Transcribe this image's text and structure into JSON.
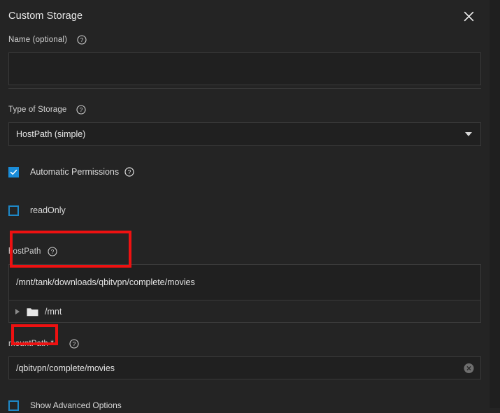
{
  "dialog": {
    "title": "Custom Storage",
    "close_icon": "close-icon"
  },
  "fields": {
    "name": {
      "label": "Name (optional)",
      "value": "",
      "placeholder": "",
      "help_icon": "help-circle-icon"
    },
    "type_of_storage": {
      "label": "Type of Storage",
      "selected": "HostPath (simple)",
      "help_icon": "help-circle-icon",
      "chevron_icon": "chevron-down-icon"
    },
    "automatic_permissions": {
      "label": "Automatic Permissions",
      "checked": true,
      "help_icon": "help-circle-icon"
    },
    "read_only": {
      "label": "readOnly",
      "checked": false
    },
    "host_path": {
      "label": "hostPath",
      "value": "/mnt/tank/downloads/qbitvpn/complete/movies",
      "help_icon": "help-circle-icon",
      "tree": [
        {
          "label": "/mnt",
          "expanded": false,
          "caret_icon": "caret-right-icon",
          "folder_icon": "folder-icon"
        }
      ]
    },
    "mount_path": {
      "label": "mountPath *",
      "value": "/qbitvpn/complete/movies",
      "help_icon": "help-circle-icon",
      "clear_icon": "clear-circle-icon"
    },
    "show_advanced_options": {
      "label": "Show Advanced Options",
      "checked": false
    }
  },
  "annotations": [
    {
      "name": "hostpath-highlight",
      "color": "#ee1111"
    },
    {
      "name": "mountpath-highlight",
      "color": "#ee1111"
    }
  ],
  "colors": {
    "background": "#242424",
    "input_background": "#202020",
    "border": "#3a3a3a",
    "accent_blue": "#1a8cd8",
    "annotation_red": "#ee1111",
    "text_primary": "#e8e8e8",
    "text_secondary": "#d2d2d2"
  }
}
